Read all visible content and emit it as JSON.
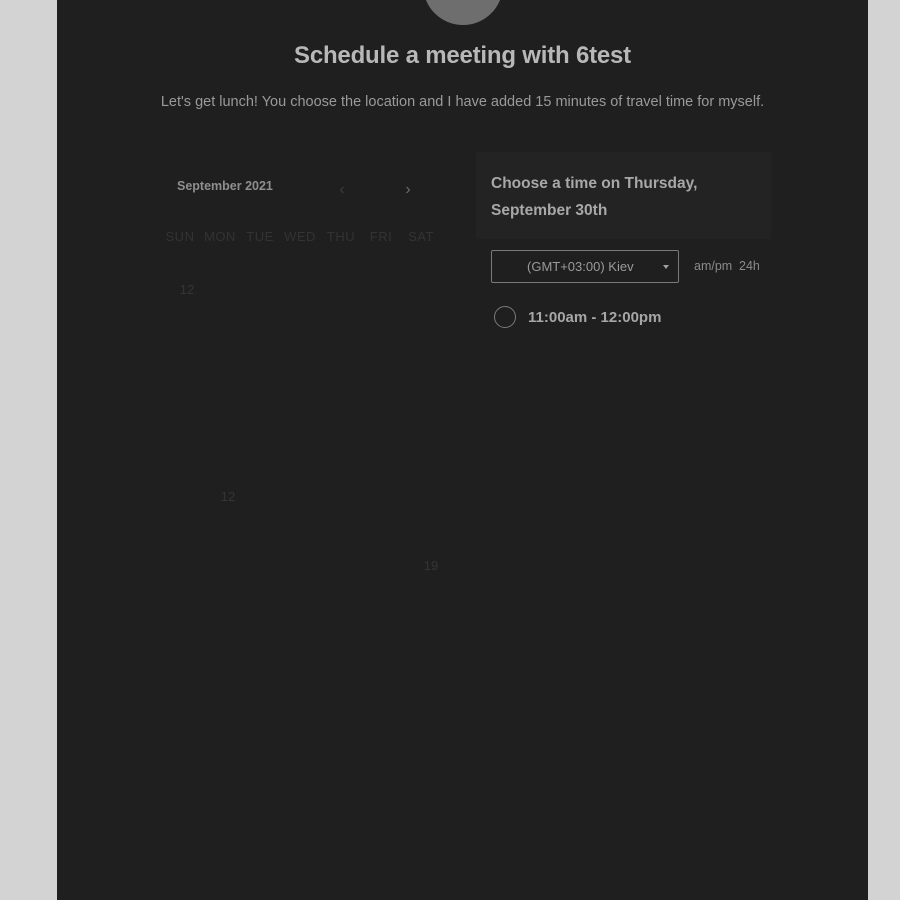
{
  "header": {
    "title": "Schedule a meeting with 6test",
    "description": "Let's get lunch! You choose the location and I have added 15 minutes of travel time for myself."
  },
  "calendar": {
    "month_label": "September 2021",
    "prev_icon": "chevron-left-icon",
    "next_icon": "chevron-right-icon",
    "weekdays": [
      "SUN",
      "MON",
      "TUE",
      "WED",
      "THU",
      "FRI",
      "SAT"
    ],
    "visible_days": [
      "12",
      "12",
      "19"
    ]
  },
  "time_panel": {
    "heading": "Choose a time on Thursday, September 30th",
    "timezone": "(GMT+03:00) Kiev",
    "format_ampm": "am/pm",
    "format_24h": "24h",
    "slots": [
      {
        "label": "11:00am - 12:00pm"
      }
    ]
  },
  "colors": {
    "panel_background": "#1f1f1f",
    "page_background": "#d3d3d3",
    "avatar": "#6e6e6e"
  }
}
